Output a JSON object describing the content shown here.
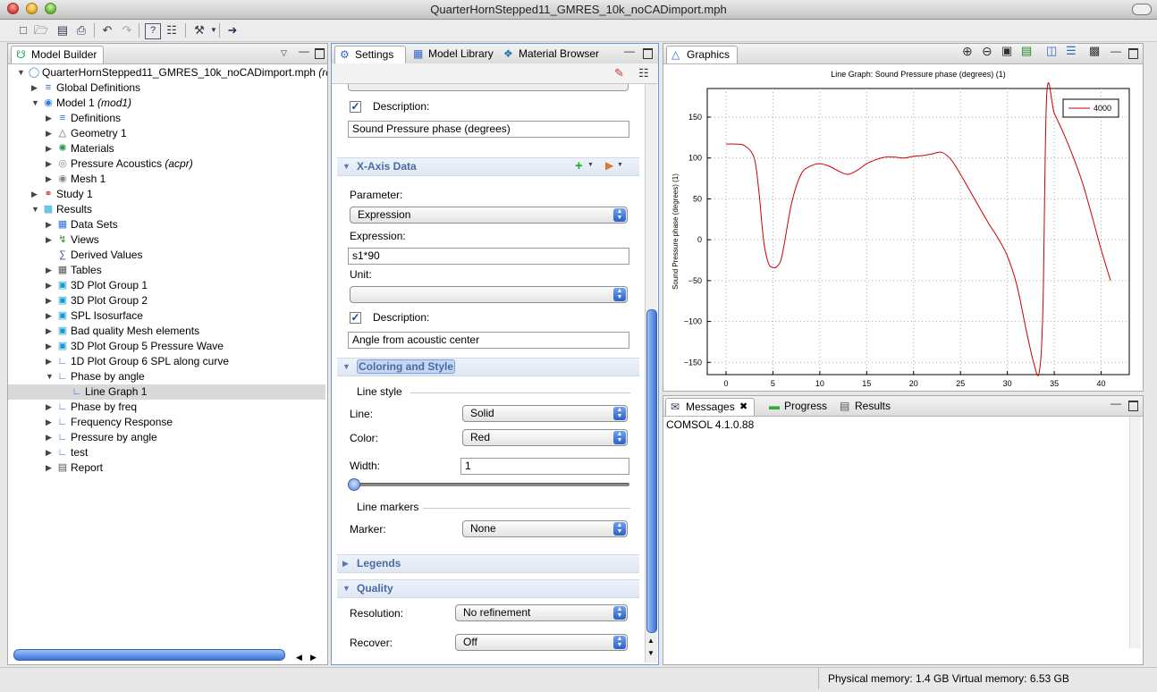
{
  "window": {
    "title": "QuarterHornStepped11_GMRES_10k_noCADimport.mph"
  },
  "toolbar": {
    "icons": [
      "new-file-icon",
      "open-file-icon",
      "save-icon",
      "print-icon",
      "undo-icon",
      "redo-icon",
      "help-icon",
      "dynamic-help-icon",
      "clear-icon",
      "export-icon"
    ]
  },
  "model_builder": {
    "tab_label": "Model Builder",
    "tree": [
      {
        "label": "QuarterHornStepped11_GMRES_10k_noCADimport.mph",
        "suffix": "(ro",
        "icon": "mph-file-icon",
        "level": 0,
        "expanded": true
      },
      {
        "label": "Global Definitions",
        "icon": "global-definitions-icon",
        "level": 1,
        "expanded": false
      },
      {
        "label": "Model 1",
        "suffix": "(mod1)",
        "icon": "model-icon",
        "level": 1,
        "expanded": true
      },
      {
        "label": "Definitions",
        "icon": "definitions-icon",
        "level": 2,
        "expanded": false
      },
      {
        "label": "Geometry 1",
        "icon": "geometry-icon",
        "level": 2,
        "expanded": false
      },
      {
        "label": "Materials",
        "icon": "materials-icon",
        "level": 2,
        "expanded": false
      },
      {
        "label": "Pressure Acoustics",
        "suffix": "(acpr)",
        "icon": "physics-icon",
        "level": 2,
        "expanded": false
      },
      {
        "label": "Mesh 1",
        "icon": "mesh-icon",
        "level": 2,
        "expanded": false
      },
      {
        "label": "Study 1",
        "icon": "study-icon",
        "level": 1,
        "expanded": false
      },
      {
        "label": "Results",
        "icon": "results-icon",
        "level": 1,
        "expanded": true
      },
      {
        "label": "Data Sets",
        "icon": "data-sets-icon",
        "level": 2,
        "expanded": false
      },
      {
        "label": "Views",
        "icon": "views-icon",
        "level": 2,
        "expanded": false
      },
      {
        "label": "Derived Values",
        "icon": "derived-values-icon",
        "level": 2,
        "expanded": null
      },
      {
        "label": "Tables",
        "icon": "tables-icon",
        "level": 2,
        "expanded": false
      },
      {
        "label": "3D Plot Group 1",
        "icon": "plot-group-3d-icon",
        "level": 2,
        "expanded": false
      },
      {
        "label": "3D Plot Group 2",
        "icon": "plot-group-3d-icon",
        "level": 2,
        "expanded": false
      },
      {
        "label": "SPL Isosurface",
        "icon": "plot-group-3d-icon",
        "level": 2,
        "expanded": false
      },
      {
        "label": "Bad quality Mesh elements",
        "icon": "plot-group-3d-icon",
        "level": 2,
        "expanded": false
      },
      {
        "label": "3D Plot Group 5 Pressure Wave",
        "icon": "plot-group-3d-icon",
        "level": 2,
        "expanded": false
      },
      {
        "label": "1D Plot Group 6 SPL along curve",
        "icon": "plot-group-1d-icon",
        "level": 2,
        "expanded": false
      },
      {
        "label": "Phase by angle",
        "icon": "plot-group-1d-icon",
        "level": 2,
        "expanded": true
      },
      {
        "label": "Line Graph 1",
        "icon": "line-graph-icon",
        "level": 3,
        "expanded": null,
        "selected": true
      },
      {
        "label": "Phase by freq",
        "icon": "plot-group-1d-icon",
        "level": 2,
        "expanded": false
      },
      {
        "label": "Frequency Response",
        "icon": "plot-group-1d-icon",
        "level": 2,
        "expanded": false
      },
      {
        "label": "Pressure by angle",
        "icon": "plot-group-1d-icon",
        "level": 2,
        "expanded": false
      },
      {
        "label": "test",
        "icon": "plot-group-1d-icon",
        "level": 2,
        "expanded": false
      },
      {
        "label": "Report",
        "icon": "report-icon",
        "level": 2,
        "expanded": false
      }
    ]
  },
  "settings": {
    "tabs": [
      {
        "label": "Settings",
        "icon": "settings-icon",
        "active": true
      },
      {
        "label": "Model Library",
        "icon": "model-library-icon",
        "active": false
      },
      {
        "label": "Material Browser",
        "icon": "material-browser-icon",
        "active": false
      }
    ],
    "y_description_label": "Description:",
    "y_description_value": "Sound Pressure phase (degrees)",
    "x_axis_section": "X-Axis Data",
    "parameter_label": "Parameter:",
    "parameter_value": "Expression",
    "expression_label": "Expression:",
    "expression_value": "s1*90",
    "unit_label": "Unit:",
    "unit_value": "",
    "x_description_label": "Description:",
    "x_description_value": "Angle from acoustic center",
    "coloring_section": "Coloring and Style",
    "line_style_heading": "Line style",
    "line_label": "Line:",
    "line_value": "Solid",
    "color_label": "Color:",
    "color_value": "Red",
    "width_label": "Width:",
    "width_value": "1",
    "line_markers_heading": "Line markers",
    "marker_label": "Marker:",
    "marker_value": "None",
    "legends_section": "Legends",
    "quality_section": "Quality",
    "resolution_label": "Resolution:",
    "resolution_value": "No refinement",
    "recover_label": "Recover:",
    "recover_value": "Off"
  },
  "graphics": {
    "tab_label": "Graphics",
    "toolbar_icons": [
      "zoom-in-icon",
      "zoom-out-icon",
      "zoom-box-icon",
      "zoom-extents-icon",
      "grid-icon",
      "legend-icon",
      "camera-icon"
    ]
  },
  "chart_data": {
    "type": "line",
    "title": "Line Graph: Sound Pressure phase (degrees) (1)",
    "xlabel": "Angle from acoustic center",
    "ylabel": "Sound Pressure phase (degrees) (1)",
    "xlim": [
      -2,
      43
    ],
    "ylim": [
      -165,
      185
    ],
    "xticks": [
      0,
      5,
      10,
      15,
      20,
      25,
      30,
      35,
      40
    ],
    "yticks": [
      -150,
      -100,
      -50,
      0,
      50,
      100,
      150
    ],
    "grid": true,
    "legend_position": "top-right",
    "line_color": "#cc0000",
    "series": [
      {
        "name": "4000",
        "x": [
          0,
          1,
          2,
          3,
          3.5,
          4,
          4.5,
          5,
          5.5,
          6,
          7,
          8,
          9,
          10,
          11,
          12,
          13,
          14,
          15,
          16,
          17,
          18,
          19,
          20,
          21,
          22,
          23,
          24,
          25,
          26,
          27,
          28,
          29,
          30,
          31,
          32,
          32.8,
          33.4,
          33.8,
          34.2,
          35,
          36,
          37,
          38,
          39,
          40,
          41
        ],
        "y": [
          117,
          117,
          115,
          100,
          60,
          0,
          -28,
          -34,
          -32,
          -18,
          45,
          80,
          90,
          93,
          90,
          84,
          80,
          85,
          93,
          98,
          101,
          101,
          100,
          102,
          103,
          105,
          107,
          98,
          80,
          60,
          40,
          20,
          2,
          -20,
          -55,
          -110,
          -150,
          -162,
          -80,
          178,
          155,
          130,
          102,
          70,
          30,
          -12,
          -50
        ]
      }
    ]
  },
  "messages": {
    "tabs": [
      {
        "label": "Messages",
        "icon": "messages-icon",
        "active": true
      },
      {
        "label": "Progress",
        "icon": "progress-icon",
        "active": false
      },
      {
        "label": "Results",
        "icon": "results-table-icon",
        "active": false
      }
    ],
    "content": "COMSOL 4.1.0.88"
  },
  "status": {
    "text": "Physical memory: 1.4 GB  Virtual memory: 6.53 GB"
  }
}
